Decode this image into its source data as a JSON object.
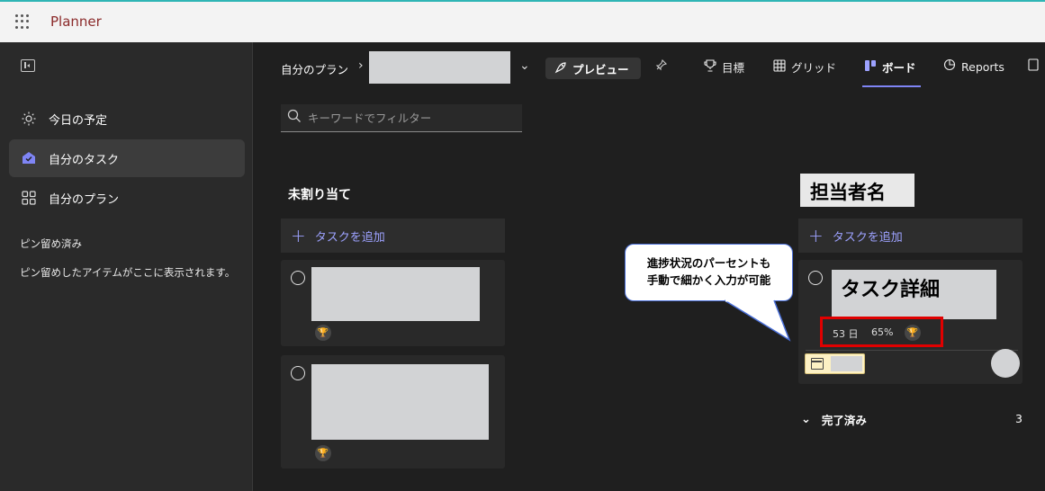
{
  "app": {
    "name": "Planner"
  },
  "sidebar": {
    "items": [
      {
        "label": "今日の予定",
        "icon": "sun-icon"
      },
      {
        "label": "自分のタスク",
        "icon": "my-tasks-icon",
        "active": true
      },
      {
        "label": "自分のプラン",
        "icon": "grid-plans-icon"
      }
    ],
    "pinned_section": "ピン留め済み",
    "pinned_empty": "ピン留めしたアイテムがここに表示されます。"
  },
  "header": {
    "breadcrumb": "自分のプラン",
    "preview_label": "プレビュー",
    "tabs": [
      {
        "label": "目標",
        "icon": "trophy-icon"
      },
      {
        "label": "グリッド",
        "icon": "grid-icon"
      },
      {
        "label": "ボード",
        "icon": "board-icon",
        "active": true
      },
      {
        "label": "Reports",
        "icon": "reports-icon"
      }
    ]
  },
  "filter": {
    "placeholder": "キーワードでフィルター"
  },
  "columns": [
    {
      "title": "未割り当て",
      "add_label": "タスクを追加"
    },
    {
      "title": "担当者名",
      "add_label": "タスクを追加"
    }
  ],
  "task_card": {
    "title": "タスク詳細",
    "days": "53 日",
    "progress": "65%"
  },
  "callout": {
    "line1": "進捗状況のパーセントも",
    "line2": "手動で細かく入力が可能"
  },
  "completed": {
    "label": "完了済み",
    "count": "3"
  },
  "colors": {
    "accent": "#7f85f5",
    "highlight": "#e00000",
    "background": "#1f1f1f"
  }
}
